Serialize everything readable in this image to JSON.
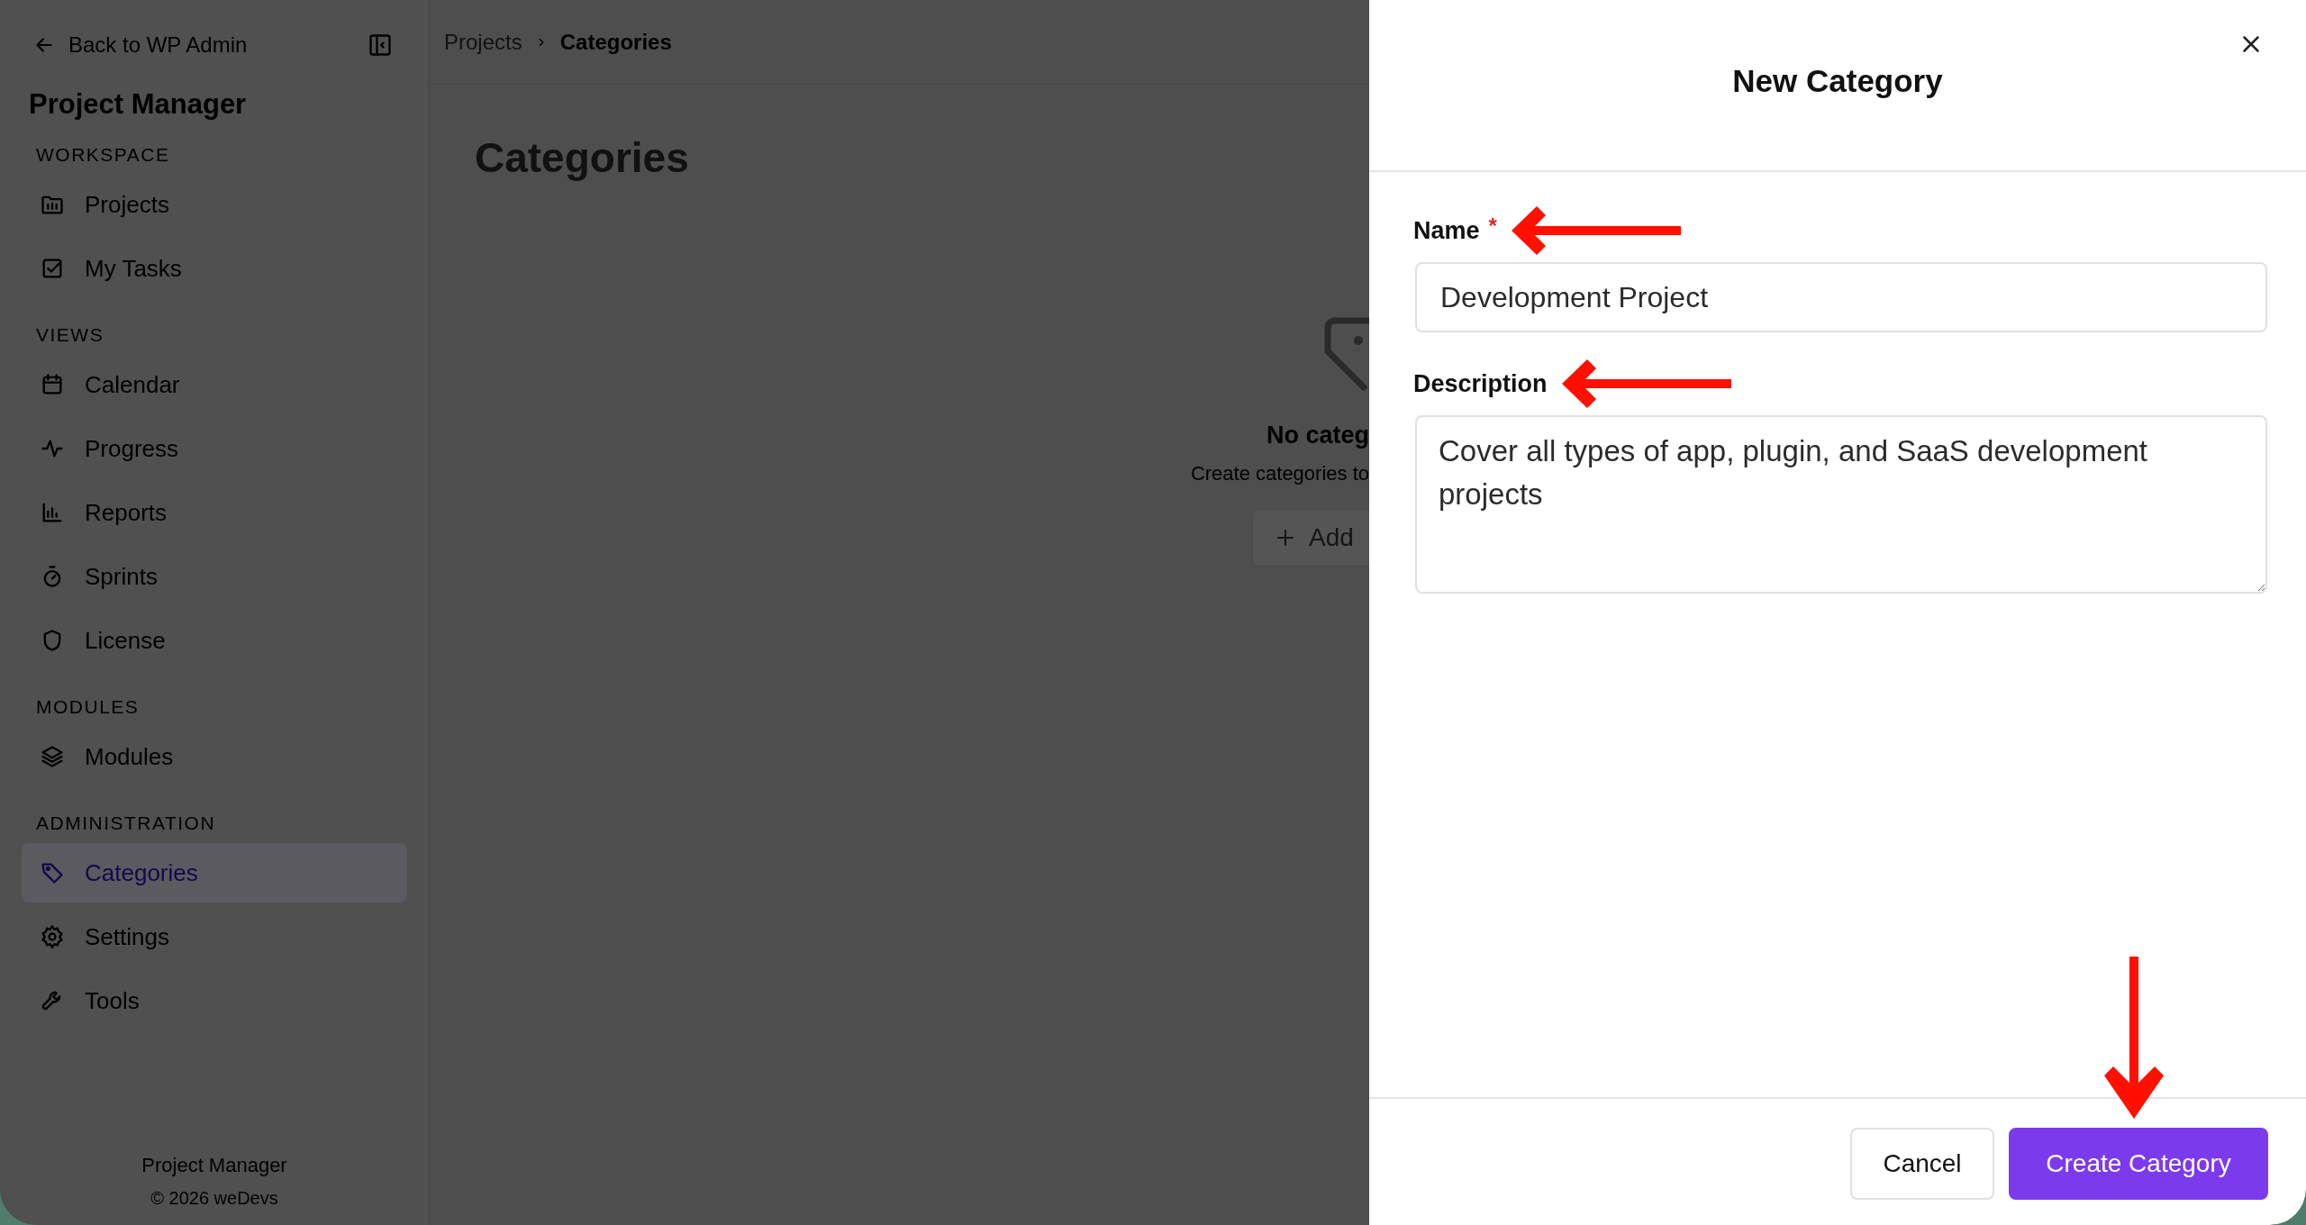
{
  "sidebar": {
    "back_link": "Back to WP Admin",
    "title": "Project Manager",
    "sections": [
      {
        "heading": "WORKSPACE",
        "items": [
          {
            "label": "Projects",
            "selected": false
          },
          {
            "label": "My Tasks",
            "selected": false
          }
        ]
      },
      {
        "heading": "VIEWS",
        "items": [
          {
            "label": "Calendar",
            "selected": false
          },
          {
            "label": "Progress",
            "selected": false
          },
          {
            "label": "Reports",
            "selected": false
          },
          {
            "label": "Sprints",
            "selected": false
          },
          {
            "label": "License",
            "selected": false
          }
        ]
      },
      {
        "heading": "MODULES",
        "items": [
          {
            "label": "Modules",
            "selected": false
          }
        ]
      },
      {
        "heading": "ADMINISTRATION",
        "items": [
          {
            "label": "Categories",
            "selected": true
          },
          {
            "label": "Settings",
            "selected": false
          },
          {
            "label": "Tools",
            "selected": false
          }
        ]
      }
    ],
    "footer": {
      "name": "Project Manager",
      "copyright": "© 2026 weDevs"
    }
  },
  "breadcrumb": [
    {
      "label": "Projects",
      "current": false
    },
    {
      "label": "Categories",
      "current": true
    }
  ],
  "page_title": "Categories",
  "empty_state": {
    "title": "No categ",
    "text": "Create categories to",
    "button": "Add"
  },
  "dialog": {
    "title": "New Category",
    "fields": [
      {
        "kind": "input",
        "label": "Name",
        "required_mark": "*",
        "value": "Development Project"
      },
      {
        "kind": "textarea",
        "label": "Description",
        "value": "Cover all types of app, plugin, and SaaS development projects"
      }
    ],
    "buttons": [
      {
        "label": "Cancel",
        "kind": "secondary"
      },
      {
        "label": "Create Category",
        "kind": "primary"
      }
    ]
  }
}
